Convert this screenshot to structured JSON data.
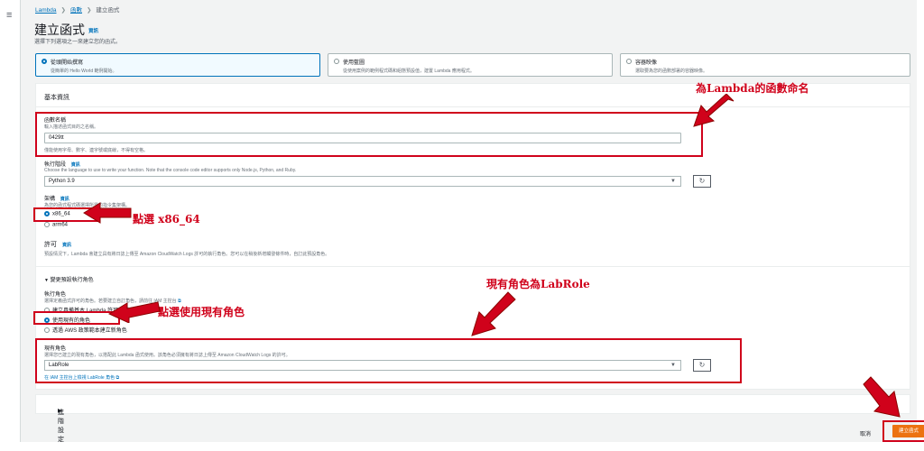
{
  "breadcrumb": {
    "root": "Lambda",
    "functions": "函數",
    "current": "建立函式"
  },
  "page": {
    "title": "建立函式",
    "info": "資訊",
    "subtitle": "選擇下列選項之一來建立您的函式。"
  },
  "options": [
    {
      "title": "從頭開始撰寫",
      "desc": "從簡單的 Hello World 範例開始。",
      "selected": true
    },
    {
      "title": "使用藍圖",
      "desc": "從使用案例的範例程式碼和組態預設值，建置 Lambda 應用程式。",
      "selected": false
    },
    {
      "title": "容器映像",
      "desc": "選取要為您的函數部署的容器映像。",
      "selected": false
    }
  ],
  "basic": {
    "header": "基本資訊",
    "function_name": {
      "label": "函數名稱",
      "desc": "輸入描述函式目的之名稱。",
      "value": "0429tt",
      "hint": "僅能使用字母、數字、連字號或底線，不得有空格。"
    },
    "runtime": {
      "label": "執行階段",
      "info": "資訊",
      "desc": "Choose the language to use to write your function. Note that the console code editor supports only Node.js, Python, and Ruby.",
      "value": "Python 3.9"
    },
    "arch": {
      "label": "架構",
      "info": "資訊",
      "desc": "為您的函式程式碼選擇所需的指令集架構。",
      "options": [
        "x86_64",
        "arm64"
      ],
      "selected": "x86_64"
    },
    "perm": {
      "label": "許可",
      "info": "資訊",
      "desc": "預設情況下，Lambda 會建立具有將日誌上傳至 Amazon CloudWatch Logs 許可的執行角色。您可以在稍後新增觸發條件時，自訂此預設角色。"
    }
  },
  "exec_role": {
    "toggle": "變更預設執行角色",
    "label": "執行角色",
    "desc": "選擇定義函式許可的角色。若要建立自訂角色，請前往 IAM 主控台",
    "options": [
      "建立具備基本 Lambda 許可的新角色",
      "使用現有的角色",
      "透過 AWS 政策範本建立新角色"
    ],
    "selected": "使用現有的角色"
  },
  "existing_role": {
    "label": "現有角色",
    "desc": "選擇您已建立的現有角色，以搭配此 Lambda 函式使用。該角色必須擁有將日誌上傳至 Amazon CloudWatch Logs 的許可。",
    "value": "LabRole",
    "link": "在 IAM 主控台上檢視 LabRole 角色"
  },
  "advanced": {
    "label": "進階設定"
  },
  "footer": {
    "cancel": "取消",
    "create": "建立函式"
  },
  "annotations": {
    "name_note": "為Lambda的函數命名",
    "arch_note": "點選 x86_64",
    "role_note": "點選使用現有角色",
    "labrole_note": "現有角色為LabRole"
  },
  "colors": {
    "annotation": "#d0021b",
    "primary": "#ec7211",
    "link": "#0073bb"
  }
}
